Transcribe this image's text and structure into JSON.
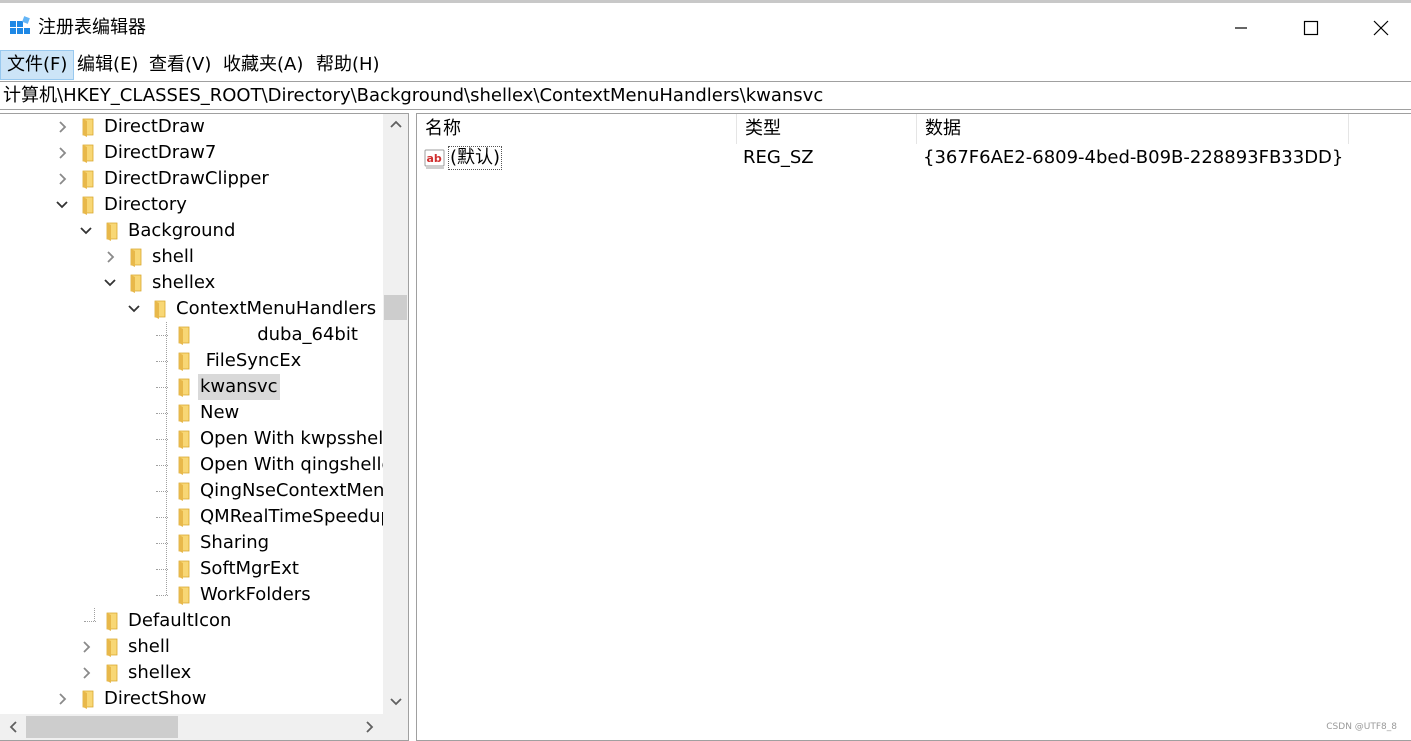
{
  "window": {
    "title": "注册表编辑器"
  },
  "menu": [
    {
      "label": "文件(F)",
      "active": true
    },
    {
      "label": "编辑(E)",
      "active": false
    },
    {
      "label": "查看(V)",
      "active": false
    },
    {
      "label": "收藏夹(A)",
      "active": false
    },
    {
      "label": "帮助(H)",
      "active": false
    }
  ],
  "address": {
    "path": "计算机\\HKEY_CLASSES_ROOT\\Directory\\Background\\shellex\\ContextMenuHandlers\\kwansvc"
  },
  "tree": [
    {
      "label": "DirectDraw",
      "level": 0,
      "state": "collapsed"
    },
    {
      "label": "DirectDraw7",
      "level": 0,
      "state": "collapsed"
    },
    {
      "label": "DirectDrawClipper",
      "level": 0,
      "state": "collapsed"
    },
    {
      "label": "Directory",
      "level": 0,
      "state": "expanded"
    },
    {
      "label": "Background",
      "level": 1,
      "state": "expanded"
    },
    {
      "label": "shell",
      "level": 2,
      "state": "collapsed"
    },
    {
      "label": "shellex",
      "level": 2,
      "state": "expanded"
    },
    {
      "label": "ContextMenuHandlers",
      "level": 3,
      "state": "expanded"
    },
    {
      "label": "          duba_64bit",
      "level": 4,
      "state": "leaf"
    },
    {
      "label": " FileSyncEx",
      "level": 4,
      "state": "leaf"
    },
    {
      "label": "kwansvc",
      "level": 4,
      "state": "leaf",
      "selected": true
    },
    {
      "label": "New",
      "level": 4,
      "state": "leaf"
    },
    {
      "label": "Open With kwpsshell",
      "level": 4,
      "state": "leaf"
    },
    {
      "label": "Open With qingshellext",
      "level": 4,
      "state": "leaf"
    },
    {
      "label": "QingNseContextMenu",
      "level": 4,
      "state": "leaf"
    },
    {
      "label": "QMRealTimeSpeedup",
      "level": 4,
      "state": "leaf"
    },
    {
      "label": "Sharing",
      "level": 4,
      "state": "leaf"
    },
    {
      "label": "SoftMgrExt",
      "level": 4,
      "state": "leaf"
    },
    {
      "label": "WorkFolders",
      "level": 4,
      "state": "leaf"
    },
    {
      "label": "DefaultIcon",
      "level": 1,
      "state": "leaf"
    },
    {
      "label": "shell",
      "level": 1,
      "state": "collapsed"
    },
    {
      "label": "shellex",
      "level": 1,
      "state": "collapsed"
    },
    {
      "label": "DirectShow",
      "level": 0,
      "state": "collapsed"
    }
  ],
  "values": {
    "columns": [
      "名称",
      "类型",
      "数据"
    ],
    "rows": [
      {
        "name": "(默认)",
        "type": "REG_SZ",
        "data": "{367F6AE2-6809-4bed-B09B-228893FB33DD}",
        "icon": "string-value-icon"
      }
    ]
  },
  "watermark": "CSDN @UTF8_8",
  "colors": {
    "menu_active_bg": "#cce4f7",
    "selection_bg": "#d9d9d9",
    "folder_yellow": "#f8d775",
    "border": "#a0a0a0"
  }
}
